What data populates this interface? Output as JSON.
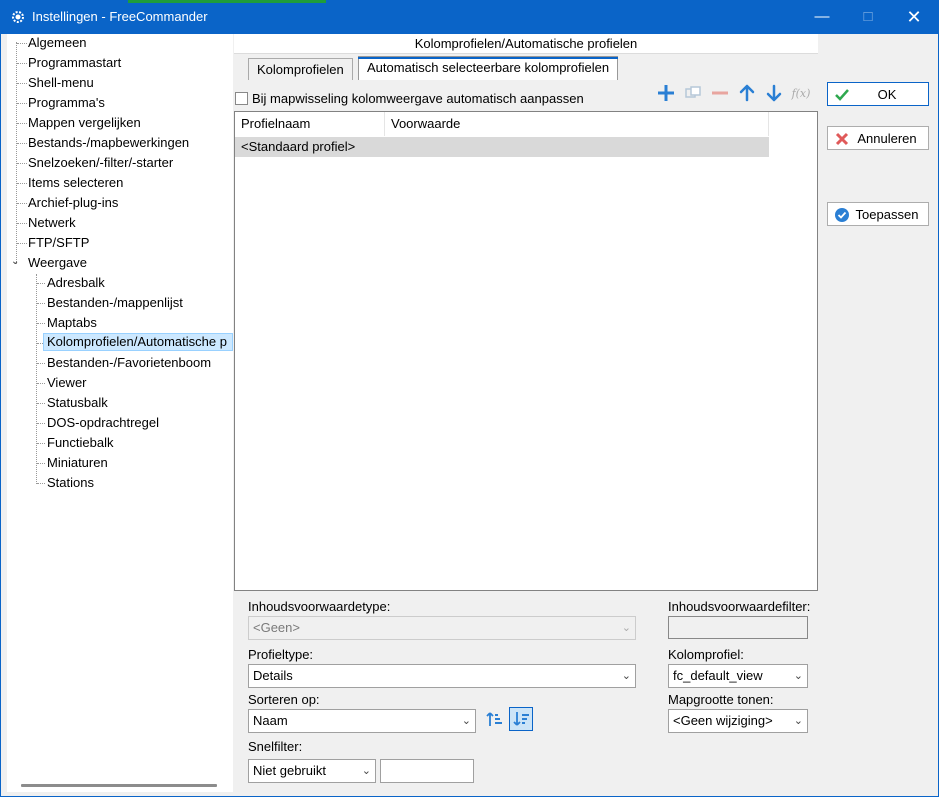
{
  "window": {
    "title": "Instellingen - FreeCommander"
  },
  "tree": {
    "items": [
      {
        "label": "Algemeen"
      },
      {
        "label": "Programmastart"
      },
      {
        "label": "Shell-menu"
      },
      {
        "label": "Programma's"
      },
      {
        "label": "Mappen vergelijken"
      },
      {
        "label": "Bestands-/mapbewerkingen"
      },
      {
        "label": "Snelzoeken/-filter/-starter"
      },
      {
        "label": "Items selecteren"
      },
      {
        "label": "Archief-plug-ins"
      },
      {
        "label": "Netwerk"
      },
      {
        "label": "FTP/SFTP"
      },
      {
        "label": "Weergave"
      }
    ],
    "children": [
      {
        "label": "Adresbalk"
      },
      {
        "label": "Bestanden-/mappenlijst"
      },
      {
        "label": "Maptabs"
      },
      {
        "label": "Kolomprofielen/Automatische p"
      },
      {
        "label": "Bestanden-/Favorietenboom"
      },
      {
        "label": "Viewer"
      },
      {
        "label": "Statusbalk"
      },
      {
        "label": "DOS-opdrachtregel"
      },
      {
        "label": "Functiebalk"
      },
      {
        "label": "Miniaturen"
      },
      {
        "label": "Stations"
      }
    ]
  },
  "panel": {
    "title": "Kolomprofielen/Automatische profielen",
    "tabs": [
      {
        "label": "Kolomprofielen"
      },
      {
        "label": "Automatisch selecteerbare kolomprofielen"
      }
    ],
    "checkbox_label": "Bij mapwisseling kolomweergave automatisch aanpassen",
    "grid": {
      "columns": [
        "Profielnaam",
        "Voorwaarde"
      ],
      "rows": [
        "<Standaard profiel>"
      ]
    },
    "content_condition_type": {
      "label": "Inhoudsvoorwaardetype:",
      "value": "<Geen>"
    },
    "content_condition_filter": {
      "label": "Inhoudsvoorwaardefilter:"
    },
    "profile_type": {
      "label": "Profieltype:",
      "value": "Details"
    },
    "column_profile": {
      "label": "Kolomprofiel:",
      "value": "fc_default_view"
    },
    "sort_on": {
      "label": "Sorteren op:",
      "value": "Naam"
    },
    "folder_size": {
      "label": "Mapgrootte tonen:",
      "value": "<Geen wijziging>"
    },
    "quick_filter": {
      "label": "Snelfilter:",
      "value": "Niet gebruikt"
    }
  },
  "buttons": {
    "ok": "OK",
    "cancel": "Annuleren",
    "apply": "Toepassen"
  },
  "colors": {
    "titlebar": "#0a64c8",
    "accent": "#2a7fd4",
    "selection": "#cce8ff",
    "danger": "#e05a5a"
  }
}
